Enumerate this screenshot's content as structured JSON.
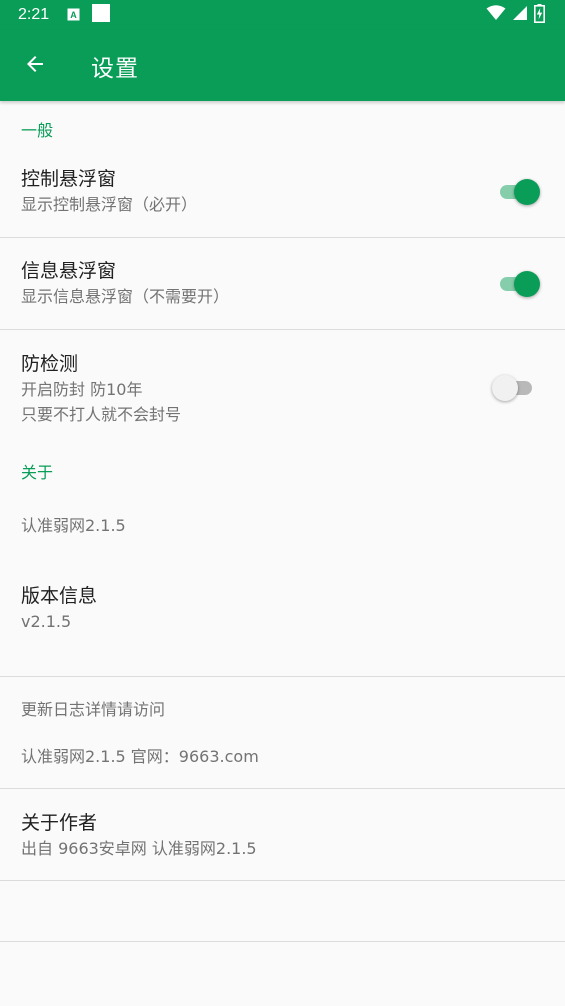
{
  "status_bar": {
    "time": "2:21",
    "left_icons": [
      "a-icon",
      "square-icon"
    ],
    "right_icons": [
      "wifi-icon",
      "signal-icon",
      "battery-charging-icon"
    ]
  },
  "app_bar": {
    "back_icon": "arrow-left-icon",
    "title": "设置"
  },
  "general": {
    "header": "一般",
    "control_float": {
      "title": "控制悬浮窗",
      "summary": "显示控制悬浮窗（必开）",
      "checked": true
    },
    "info_float": {
      "title": "信息悬浮窗",
      "summary": "显示信息悬浮窗（不需要开）",
      "checked": true
    },
    "anti_detect": {
      "title": "防检测",
      "summary_line1": "开启防封 防10年",
      "summary_line2": "只要不打人就不会封号",
      "checked": false
    }
  },
  "about": {
    "header": "关于",
    "app_name": "认准弱网2.1.5",
    "version": {
      "title": "版本信息",
      "summary": "v2.1.5"
    },
    "changelog_line1": "更新日志详情请访问",
    "changelog_line2": "认准弱网2.1.5  官网：9663.com",
    "author": {
      "title": "关于作者",
      "summary": "出自 9663安卓网 认准弱网2.1.5"
    }
  },
  "colors": {
    "primary": "#0a9d58",
    "switch_track_on": "#86ceab",
    "switch_off_thumb": "#f1f1f1"
  }
}
